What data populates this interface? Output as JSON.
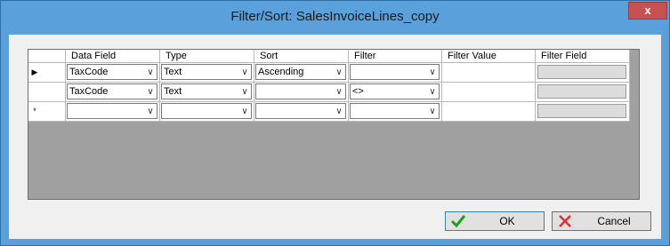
{
  "window": {
    "title": "Filter/Sort: SalesInvoiceLines_copy",
    "close_label": "x"
  },
  "grid": {
    "columns": [
      "Data Field",
      "Type",
      "Sort",
      "Filter",
      "Filter Value",
      "Filter Field"
    ],
    "rows": [
      {
        "marker": "▶",
        "data_field": "TaxCode",
        "type": "Text",
        "sort": "Ascending",
        "filter": "",
        "filter_value": ""
      },
      {
        "marker": "",
        "data_field": "TaxCode",
        "type": "Text",
        "sort": "",
        "filter": "<>",
        "filter_value": ""
      },
      {
        "marker": "*",
        "data_field": "",
        "type": "",
        "sort": "",
        "filter": "",
        "filter_value": ""
      }
    ],
    "dropdown_arrow": "∨"
  },
  "buttons": {
    "ok_label": "OK",
    "cancel_label": "Cancel"
  },
  "colors": {
    "title_bar": "#5aa0db",
    "close_button": "#c75050",
    "ok_check": "#1aa31a",
    "cancel_x": "#e03030"
  }
}
